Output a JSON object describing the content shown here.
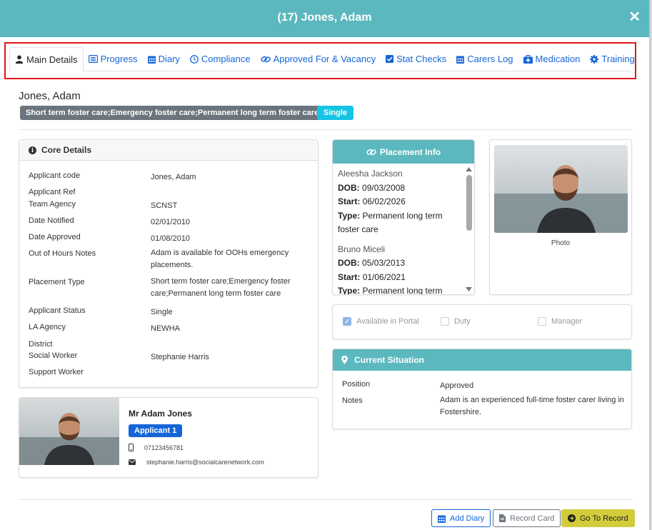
{
  "modal": {
    "title": "(17) Jones, Adam",
    "close_glyph": "✕"
  },
  "tabs": [
    {
      "label": "Main Details",
      "icon": "user-icon",
      "active": true
    },
    {
      "label": "Progress",
      "icon": "list-icon"
    },
    {
      "label": "Diary",
      "icon": "calendar-icon"
    },
    {
      "label": "Compliance",
      "icon": "clock-icon"
    },
    {
      "label": "Approved For & Vacancy",
      "icon": "link-icon"
    },
    {
      "label": "Stat Checks",
      "icon": "checkbox-icon"
    },
    {
      "label": "Carers Log",
      "icon": "calendar-icon"
    },
    {
      "label": "Medication",
      "icon": "medkit-icon"
    },
    {
      "label": "Training",
      "icon": "gear-icon"
    }
  ],
  "person": {
    "name": "Jones, Adam",
    "placement_badge": "Short term foster care;Emergency foster care;Permanent long term foster care",
    "status_badge": "Single"
  },
  "core_details": {
    "title": "Core Details",
    "rows": [
      {
        "label": "Applicant code",
        "value": "Jones, Adam"
      },
      {
        "label": "Applicant Ref",
        "value": ""
      },
      {
        "label": "Team Agency",
        "value": "SCNST"
      },
      {
        "label": "Date Notified",
        "value": "02/01/2010"
      },
      {
        "label": "Date Approved",
        "value": "01/08/2010"
      },
      {
        "label": "Out of Hours Notes",
        "value": "Adam is available for OOHs emergency placements."
      },
      {
        "label": "Placement Type",
        "value": "Short term foster care;Emergency foster care;Permanent long term foster care"
      },
      {
        "label": "Applicant Status",
        "value": "Single"
      },
      {
        "label": "LA Agency",
        "value": "NEWHA"
      },
      {
        "label": "District",
        "value": ""
      },
      {
        "label": "Social Worker",
        "value": "Stephanie Harris"
      },
      {
        "label": "Support Worker",
        "value": ""
      }
    ]
  },
  "contact": {
    "name": "Mr Adam Jones",
    "role_badge": "Applicant 1",
    "phone": "07123456781",
    "email": "stephanie.harris@socialcarenetwork.com"
  },
  "placement_info": {
    "title": "Placement Info",
    "dob_label": "DOB:",
    "start_label": "Start:",
    "type_label": "Type:",
    "entries": [
      {
        "name": "Aleesha Jackson",
        "dob": "09/03/2008",
        "start": "06/02/2026",
        "type": "Permanent long term foster care"
      },
      {
        "name": "Bruno Miceli",
        "dob": "05/03/2013",
        "start": "01/06/2021",
        "type": "Permanent long term foster care"
      }
    ]
  },
  "photo": {
    "label": "Photo"
  },
  "flags": {
    "available_in_portal": {
      "label": "Available in Portal",
      "checked": true
    },
    "duty": {
      "label": "Duty",
      "checked": false
    },
    "manager": {
      "label": "Manager",
      "checked": false
    }
  },
  "current_situation": {
    "title": "Current Situation",
    "position_label": "Position",
    "position_value": "Approved",
    "notes_label": "Notes",
    "notes_value": "Adam is an experienced full-time foster carer living in Fostershire."
  },
  "footer": {
    "add_diary": "Add Diary",
    "record_card": "Record Card",
    "go_to_record": "Go To Record"
  },
  "colors": {
    "header_teal": "#5bb8be",
    "link_blue": "#1565d8",
    "highlight_red": "#e0161d",
    "badge_gray": "#6c757d",
    "badge_cyan": "#16c4e6",
    "go_button_yellow": "#d3cc3a"
  }
}
